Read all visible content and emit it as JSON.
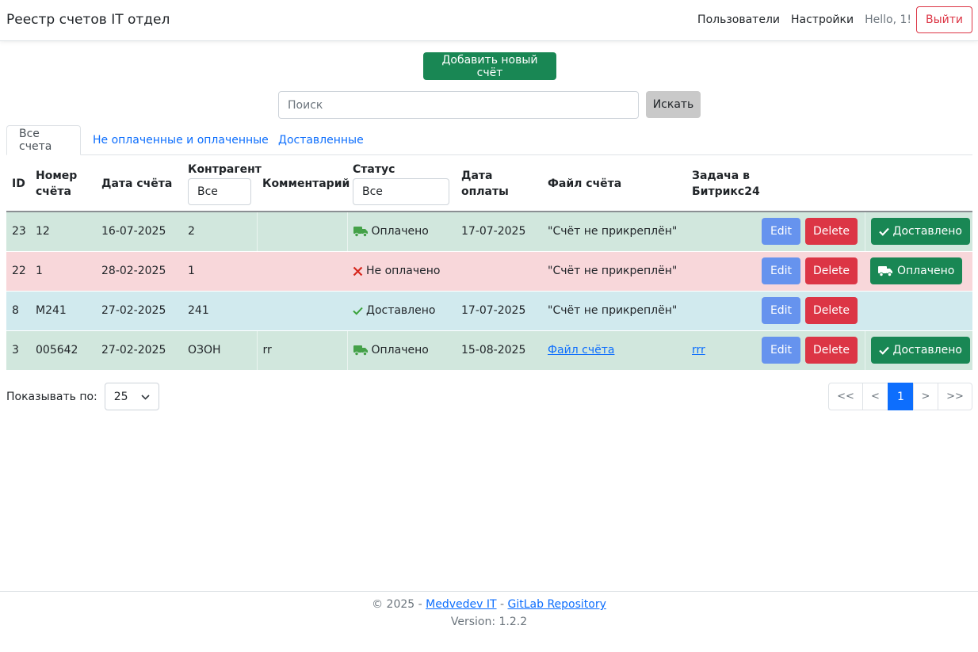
{
  "navbar": {
    "brand": "Реестр счетов IT отдел",
    "users_link": "Пользователи",
    "settings_link": "Настройки",
    "greeting": "Hello, 1!",
    "logout_label": "Выйти"
  },
  "toolbar": {
    "add_label": "Добавить новый счёт",
    "search_placeholder": "Поиск",
    "search_button": "Искать"
  },
  "tabs": [
    {
      "label": "Все счета",
      "active": true
    },
    {
      "label": "Не оплаченные и оплаченные",
      "active": false
    },
    {
      "label": "Доставленные",
      "active": false
    }
  ],
  "table": {
    "headers": {
      "id": "ID",
      "number_line1": "Номер",
      "number_line2": "счёта",
      "date": "Дата счёта",
      "contractor": "Контрагент",
      "comment": "Комментарий",
      "status": "Статус",
      "paid_date": "Дата оплаты",
      "file": "Файл счёта",
      "task_line1": "Задача в",
      "task_line2": "Битрикс24"
    },
    "filters": {
      "contractor": "Все",
      "status": "Все"
    },
    "rows": [
      {
        "id": "23",
        "number": "12",
        "date": "16-07-2025",
        "contractor": "2",
        "comment": "",
        "status": "Оплачено",
        "paid_date": "17-07-2025",
        "file": "\"Счёт не прикреплён\"",
        "task": "",
        "edit": "Edit",
        "delete": "Delete",
        "action": "Доставлено"
      },
      {
        "id": "22",
        "number": "1",
        "date": "28-02-2025",
        "contractor": "1",
        "comment": "",
        "status": "Не оплачено",
        "paid_date": "",
        "file": "\"Счёт не прикреплён\"",
        "task": "",
        "edit": "Edit",
        "delete": "Delete",
        "action": "Оплачено"
      },
      {
        "id": "8",
        "number": "M241",
        "date": "27-02-2025",
        "contractor": "241",
        "comment": "",
        "status": "Доставлено",
        "paid_date": "17-07-2025",
        "file": "\"Счёт не прикреплён\"",
        "task": "",
        "edit": "Edit",
        "delete": "Delete",
        "action": ""
      },
      {
        "id": "3",
        "number": "005642",
        "date": "27-02-2025",
        "contractor": "ОЗОН",
        "comment": "rr",
        "status": "Оплачено",
        "paid_date": "15-08-2025",
        "file": "Файл счёта",
        "task": "rrr",
        "edit": "Edit",
        "delete": "Delete",
        "action": "Доставлено"
      }
    ]
  },
  "pagination": {
    "perpage_label": "Показывать по:",
    "perpage_value": "25",
    "first": "<<",
    "prev": "<",
    "current": "1",
    "next": ">",
    "last": ">>"
  },
  "footer": {
    "copyright": "© 2025 -",
    "author_link": "Medvedev IT",
    "separator": "-",
    "repo_link": "GitLab Repository",
    "version": "Version: 1.2.2"
  },
  "colors": {
    "success": "#198754",
    "danger": "#dc3545",
    "primary": "#0d6efd",
    "edit": "#6693ee",
    "row_paid": "#d1e7dd",
    "row_unpaid": "#f8d7da",
    "row_delivered": "#d1eaee"
  }
}
